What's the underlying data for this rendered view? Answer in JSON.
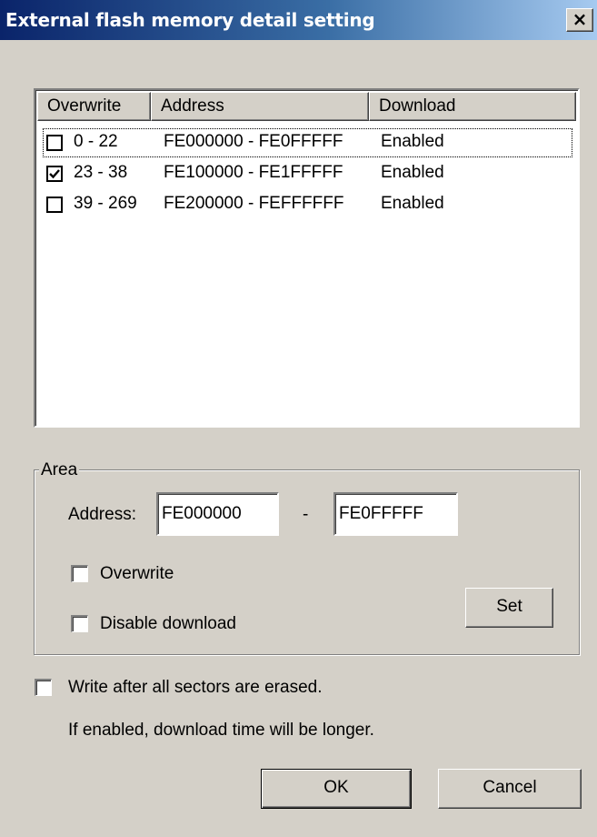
{
  "window": {
    "title": "External flash memory detail setting",
    "close_glyph": "×",
    "close_icon": "close-icon"
  },
  "list": {
    "columns": [
      "Overwrite",
      "Address",
      "Download"
    ],
    "rows": [
      {
        "checked": false,
        "range": "0 - 22",
        "address": "FE000000 - FE0FFFFF",
        "download": "Enabled"
      },
      {
        "checked": true,
        "range": "23 - 38",
        "address": "FE100000 - FE1FFFFF",
        "download": "Enabled"
      },
      {
        "checked": false,
        "range": "39 - 269",
        "address": "FE200000 - FEFFFFFF",
        "download": "Enabled"
      }
    ]
  },
  "area": {
    "legend": "Area",
    "address_label": "Address:",
    "start_address": "FE000000",
    "separator": "-",
    "end_address": "FE0FFFFF",
    "overwrite_label": "Overwrite",
    "overwrite_checked": false,
    "disable_download_label": "Disable download",
    "disable_download_checked": false,
    "set_label": "Set"
  },
  "options": {
    "write_after_erase_label": "Write after all sectors are erased.",
    "write_after_erase_checked": false,
    "note": "If enabled, download time will be longer."
  },
  "buttons": {
    "ok": "OK",
    "cancel": "Cancel"
  }
}
